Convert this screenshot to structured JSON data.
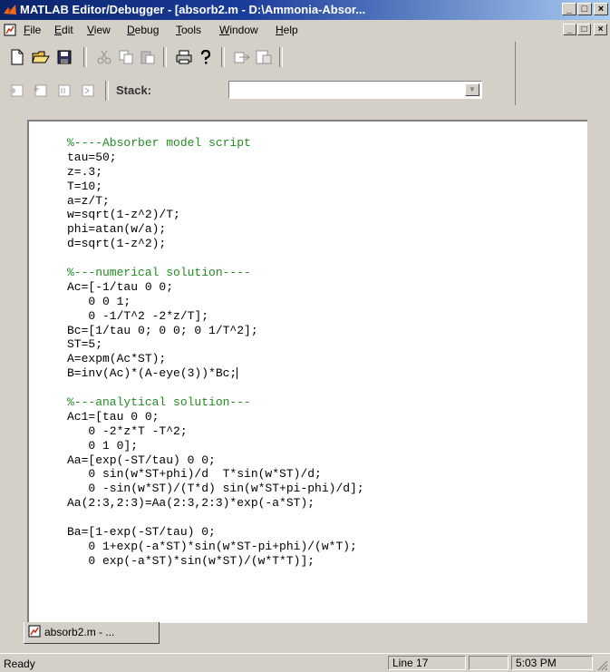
{
  "window": {
    "title": "MATLAB Editor/Debugger - [absorb2.m - D:\\Ammonia-Absor...",
    "minimize_glyph": "_",
    "maximize_glyph": "□",
    "close_glyph": "×"
  },
  "menu": {
    "items": [
      {
        "key": "F",
        "rest": "ile"
      },
      {
        "key": "E",
        "rest": "dit"
      },
      {
        "key": "V",
        "rest": "iew"
      },
      {
        "key": "D",
        "rest": "ebug"
      },
      {
        "key": "T",
        "rest": "ools"
      },
      {
        "key": "W",
        "rest": "indow"
      },
      {
        "key": "H",
        "rest": "elp"
      }
    ]
  },
  "toolbar": {
    "stack_label": "Stack:",
    "stack_value": ""
  },
  "editor": {
    "lines": [
      {
        "text": "%----Absorber model script",
        "comment": true
      },
      {
        "text": "tau=50;",
        "comment": false
      },
      {
        "text": "z=.3;",
        "comment": false
      },
      {
        "text": "T=10;",
        "comment": false
      },
      {
        "text": "a=z/T;",
        "comment": false
      },
      {
        "text": "w=sqrt(1-z^2)/T;",
        "comment": false
      },
      {
        "text": "phi=atan(w/a);",
        "comment": false
      },
      {
        "text": "d=sqrt(1-z^2);",
        "comment": false
      },
      {
        "text": "",
        "comment": false
      },
      {
        "text": "%---numerical solution----",
        "comment": true
      },
      {
        "text": "Ac=[-1/tau 0 0;",
        "comment": false
      },
      {
        "text": "   0 0 1;",
        "comment": false
      },
      {
        "text": "   0 -1/T^2 -2*z/T];",
        "comment": false
      },
      {
        "text": "Bc=[1/tau 0; 0 0; 0 1/T^2];",
        "comment": false
      },
      {
        "text": "ST=5;",
        "comment": false
      },
      {
        "text": "A=expm(Ac*ST);",
        "comment": false
      },
      {
        "text": "B=inv(Ac)*(A-eye(3))*Bc;",
        "comment": false,
        "caret": true
      },
      {
        "text": "",
        "comment": false
      },
      {
        "text": "%---analytical solution---",
        "comment": true
      },
      {
        "text": "Ac1=[tau 0 0;",
        "comment": false
      },
      {
        "text": "   0 -2*z*T -T^2;",
        "comment": false
      },
      {
        "text": "   0 1 0];",
        "comment": false
      },
      {
        "text": "Aa=[exp(-ST/tau) 0 0;",
        "comment": false
      },
      {
        "text": "   0 sin(w*ST+phi)/d  T*sin(w*ST)/d;",
        "comment": false
      },
      {
        "text": "   0 -sin(w*ST)/(T*d) sin(w*ST+pi-phi)/d];",
        "comment": false
      },
      {
        "text": "Aa(2:3,2:3)=Aa(2:3,2:3)*exp(-a*ST);",
        "comment": false
      },
      {
        "text": "",
        "comment": false
      },
      {
        "text": "Ba=[1-exp(-ST/tau) 0;",
        "comment": false
      },
      {
        "text": "   0 1+exp(-a*ST)*sin(w*ST-pi+phi)/(w*T);",
        "comment": false
      },
      {
        "text": "   0 exp(-a*ST)*sin(w*ST)/(w*T*T)];",
        "comment": false
      }
    ]
  },
  "doc_tab": {
    "label": "absorb2.m - ..."
  },
  "status": {
    "ready": "Ready",
    "line": "Line 17",
    "col": "",
    "time": "5:03 PM"
  },
  "colors": {
    "comment": "#228b22",
    "titlebar_start": "#0a246a",
    "titlebar_end": "#a6caf0"
  }
}
